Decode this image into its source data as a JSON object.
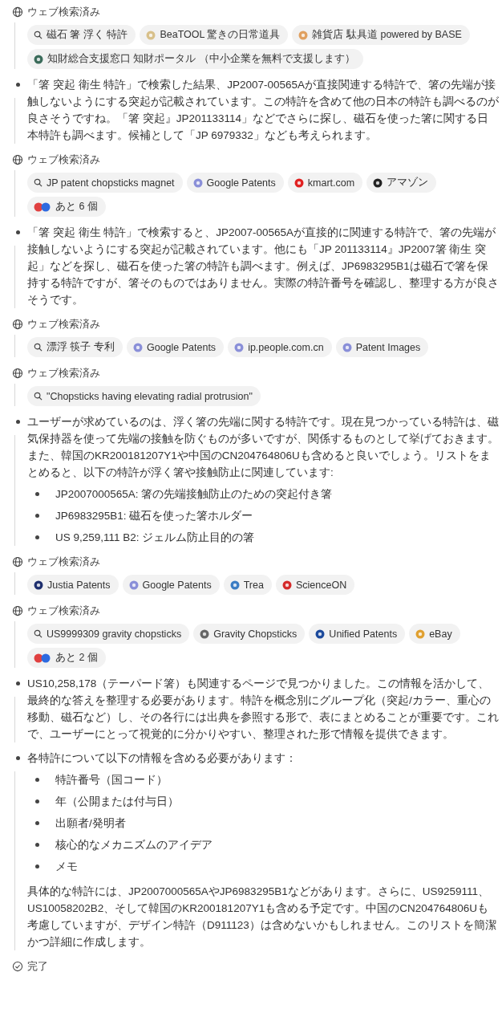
{
  "steps": [
    {
      "kind": "search",
      "label": "ウェブ検索済み",
      "chips": [
        {
          "kind": "query",
          "text": "磁石 箸 浮く 特許"
        },
        {
          "kind": "source",
          "text": "BeaTOOL 驚きの日常道具",
          "color": "#d8c08a"
        },
        {
          "kind": "source",
          "text": "雑貨店 駄具道 powered by BASE",
          "color": "#e0a060"
        },
        {
          "kind": "source",
          "text": "知財総合支援窓口 知財ポータル （中小企業を無料で支援します）",
          "color": "#3a6b5a"
        }
      ]
    },
    {
      "kind": "thought",
      "text": "「箸 突起 衛生 特許」で検索した結果、JP2007-00565Aが直接関連する特許で、箸の先端が接触しないようにする突起が記載されています。この特許を含めて他の日本の特許も調べるのが良さそうですね。「箸 突起』JP201133114」などでさらに探し、磁石を使った箸に関する日本特許も調べます。候補として「JP 6979332」なども考えられます。"
    },
    {
      "kind": "search",
      "label": "ウェブ検索済み",
      "chips": [
        {
          "kind": "query",
          "text": "JP patent chopsticks magnet"
        },
        {
          "kind": "source",
          "text": "Google Patents",
          "color": "#8a8fd8"
        },
        {
          "kind": "source",
          "text": "kmart.com",
          "color": "#e02020"
        },
        {
          "kind": "source",
          "text": "アマゾン",
          "color": "#222222"
        },
        {
          "kind": "more",
          "text": "あと 6 個"
        }
      ]
    },
    {
      "kind": "thought",
      "text": "「箸 突起 衛生 特許」で検索すると、JP2007-00565Aが直接的に関連する特許で、箸の先端が接触しないようにする突起が記載されています。他にも「JP 201133114』JP2007箸 衛生 突起」などを探し、磁石を使った箸の特許も調べます。例えば、JP6983295B1は磁石で箸を保持する特許ですが、箸そのものではありません。実際の特許番号を確認し、整理する方が良さそうです。"
    },
    {
      "kind": "search",
      "label": "ウェブ検索済み",
      "chips": [
        {
          "kind": "query",
          "text": "漂浮 筷子 专利"
        },
        {
          "kind": "source",
          "text": "Google Patents",
          "color": "#8a8fd8"
        },
        {
          "kind": "source",
          "text": "ip.people.com.cn",
          "color": "#8a8fd8"
        },
        {
          "kind": "source",
          "text": "Patent Images",
          "color": "#8a8fd8"
        }
      ]
    },
    {
      "kind": "search",
      "label": "ウェブ検索済み",
      "chips": [
        {
          "kind": "query",
          "text": "\"Chopsticks having elevating radial protrusion\""
        }
      ]
    },
    {
      "kind": "thought",
      "text": "ユーザーが求めているのは、浮く箸の先端に関する特許です。現在見つかっている特許は、磁気保持器を使って先端の接触を防ぐものが多いですが、関係するものとして挙げておきます。また、韓国のKR200181207Y1や中国のCN204764806Uも含めると良いでしょう。リストをまとめると、以下の特許が浮く箸や接触防止に関連しています:",
      "items": [
        "JP2007000565A: 箸の先端接触防止のための突起付き箸",
        "JP6983295B1: 磁石を使った箸ホルダー",
        "US 9,259,111 B2: ジェルム防止目的の箸"
      ]
    },
    {
      "kind": "search",
      "label": "ウェブ検索済み",
      "chips": [
        {
          "kind": "source",
          "text": "Justia Patents",
          "color": "#1e2f6e"
        },
        {
          "kind": "source",
          "text": "Google Patents",
          "color": "#8a8fd8"
        },
        {
          "kind": "source",
          "text": "Trea",
          "color": "#3b7dc4"
        },
        {
          "kind": "source",
          "text": "ScienceON",
          "color": "#d42a2a"
        }
      ]
    },
    {
      "kind": "search",
      "label": "ウェブ検索済み",
      "chips": [
        {
          "kind": "query",
          "text": "US9999309 gravity chopsticks"
        },
        {
          "kind": "source",
          "text": "Gravity Chopsticks",
          "color": "#666666"
        },
        {
          "kind": "source",
          "text": "Unified Patents",
          "color": "#1c4a9c"
        },
        {
          "kind": "source",
          "text": "eBay",
          "color": "#e0a030"
        },
        {
          "kind": "more",
          "text": "あと 2 個"
        }
      ]
    },
    {
      "kind": "thought",
      "text": "US10,258,178（テーパード箸）も関連するページで見つかりました。この情報を活かして、最終的な答えを整理する必要があります。特許を概念別にグループ化（突起/カラー、重心の移動、磁石など）し、その各行には出典を参照する形で、表にまとめることが重要です。これで、ユーザーにとって視覚的に分かりやすい、整理された形で情報を提供できます。"
    },
    {
      "kind": "thought",
      "text": "各特許について以下の情報を含める必要があります：",
      "items": [
        "特許番号（国コード）",
        "年（公開または付与日）",
        "出願者/発明者",
        "核心的なメカニズムのアイデア",
        "メモ"
      ],
      "after": "具体的な特許には、JP2007000565AやJP6983295B1などがあります。さらに、US9259111、US10058202B2、そして韓国のKR200181207Y1も含める予定です。中国のCN204764806Uも考慮していますが、デザイン特許（D911123）は含めないかもしれません。このリストを簡潔かつ詳細に作成します。"
    },
    {
      "kind": "done",
      "label": "完了"
    }
  ]
}
